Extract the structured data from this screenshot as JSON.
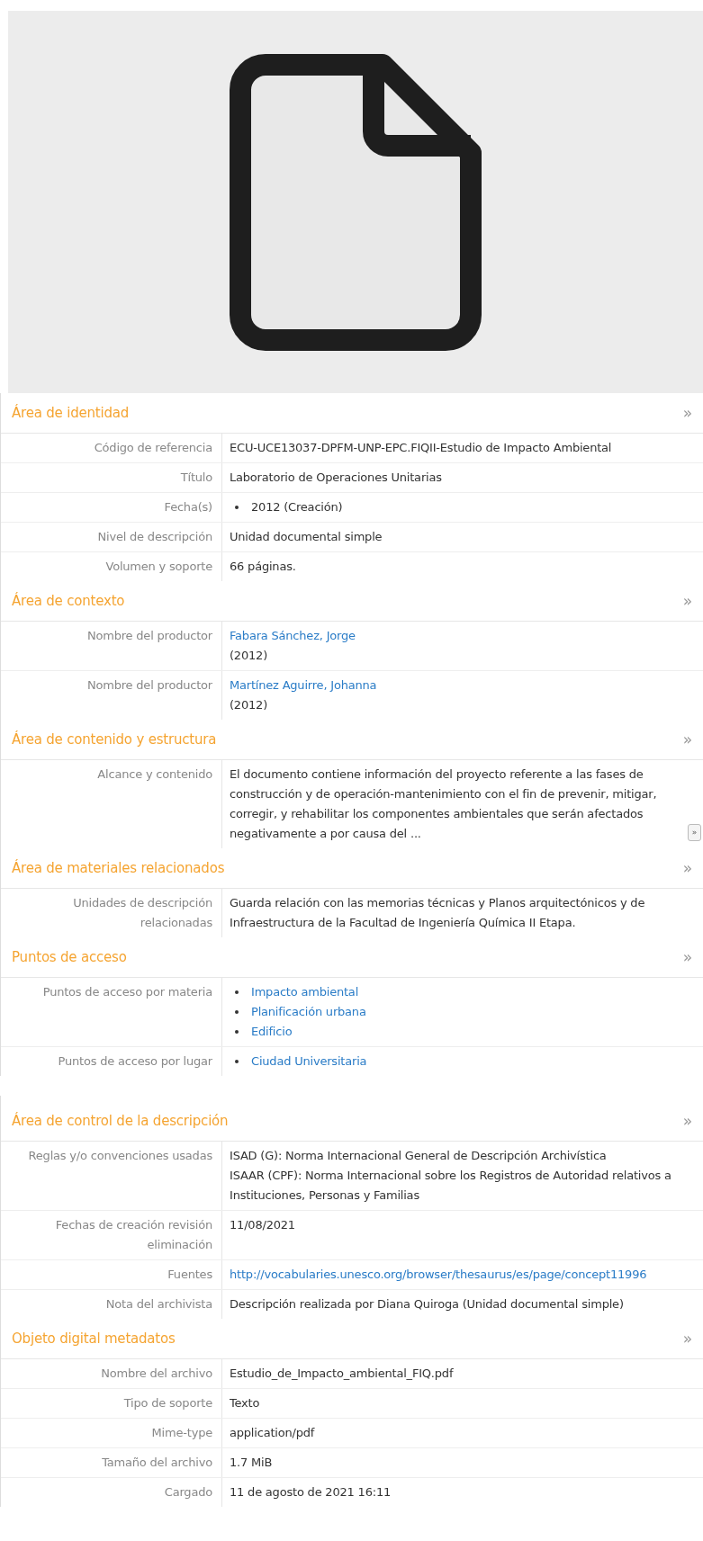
{
  "sections": [
    {
      "title": "Área de identidad",
      "toggle": "»",
      "fields": [
        {
          "label": "Código de referencia",
          "values": [
            {
              "kind": "text",
              "text": "ECU-UCE13037-DPFM-UNP-EPC.FIQII-Estudio de Impacto Ambiental"
            }
          ]
        },
        {
          "label": "Título",
          "values": [
            {
              "kind": "text",
              "text": "Laboratorio de Operaciones Unitarias"
            }
          ]
        },
        {
          "label": "Fecha(s)",
          "values": [
            {
              "kind": "bullet_text",
              "text": "2012 (Creación)"
            }
          ]
        },
        {
          "label": "Nivel de descripción",
          "values": [
            {
              "kind": "text",
              "text": "Unidad documental simple"
            }
          ]
        },
        {
          "label": "Volumen y soporte",
          "values": [
            {
              "kind": "text",
              "text": "66 páginas."
            }
          ]
        }
      ]
    },
    {
      "title": "Área de contexto",
      "toggle": "»",
      "fields": [
        {
          "label": "Nombre del productor",
          "values": [
            {
              "kind": "link",
              "text": "Fabara Sánchez, Jorge"
            },
            {
              "kind": "text",
              "text": "(2012)"
            }
          ]
        },
        {
          "label": "Nombre del productor",
          "values": [
            {
              "kind": "link",
              "text": "Martínez Aguirre, Johanna"
            },
            {
              "kind": "text",
              "text": "(2012)"
            }
          ]
        }
      ]
    },
    {
      "title": "Área de contenido y estructura",
      "toggle": "»",
      "fields": [
        {
          "label": "Alcance y contenido",
          "values": [
            {
              "kind": "text",
              "text": "El documento contiene información del proyecto referente a las fases de construcción y de operación-mantenimiento con el fin de prevenir, mitigar, corregir, y rehabilitar los componentes ambientales que serán afectados negativamente a por causa del ...",
              "more": "»"
            }
          ]
        }
      ]
    },
    {
      "title": "Área de materiales relacionados",
      "toggle": "»",
      "fields": [
        {
          "label": "Unidades de descripción relacionadas",
          "values": [
            {
              "kind": "text",
              "text": "Guarda relación con las memorias técnicas y Planos arquitectónicos y de Infraestructura de la Facultad de Ingeniería Química II Etapa."
            }
          ]
        }
      ]
    },
    {
      "title": "Puntos de acceso",
      "toggle": "»",
      "fields": [
        {
          "label": "Puntos de acceso por materia",
          "values": [
            {
              "kind": "bullet_link",
              "text": "Impacto ambiental"
            },
            {
              "kind": "bullet_link",
              "text": "Planificación urbana"
            },
            {
              "kind": "bullet_link",
              "text": "Edificio"
            }
          ]
        },
        {
          "label": "Puntos de acceso por lugar",
          "values": [
            {
              "kind": "bullet_link",
              "text": "Ciudad Universitaria"
            }
          ]
        }
      ]
    },
    {
      "title": "Área de control de la descripción",
      "toggle": "»",
      "break_before": true,
      "fields": [
        {
          "label": "Reglas y/o convenciones usadas",
          "values": [
            {
              "kind": "text",
              "text": "ISAD (G): Norma Internacional General de Descripción Archivística"
            },
            {
              "kind": "text",
              "text": "ISAAR (CPF): Norma Internacional sobre los Registros de Autoridad relativos a Instituciones, Personas y Familias"
            }
          ]
        },
        {
          "label": "Fechas de creación revisión eliminación",
          "values": [
            {
              "kind": "text",
              "text": "11/08/2021"
            }
          ]
        },
        {
          "label": "Fuentes",
          "values": [
            {
              "kind": "link",
              "text": "http://vocabularies.unesco.org/browser/thesaurus/es/page/concept11996"
            }
          ]
        },
        {
          "label": "Nota del archivista",
          "values": [
            {
              "kind": "text",
              "text": "Descripción realizada por Diana Quiroga (Unidad documental simple)"
            }
          ]
        }
      ]
    },
    {
      "title": "Objeto digital metadatos",
      "toggle": "»",
      "fields": [
        {
          "label": "Nombre del archivo",
          "values": [
            {
              "kind": "text",
              "text": "Estudio_de_Impacto_ambiental_FIQ.pdf"
            }
          ]
        },
        {
          "label": "Tipo de soporte",
          "values": [
            {
              "kind": "text",
              "text": "Texto"
            }
          ]
        },
        {
          "label": "Mime-type",
          "values": [
            {
              "kind": "text",
              "text": "application/pdf"
            }
          ]
        },
        {
          "label": "Tamaño del archivo",
          "values": [
            {
              "kind": "text",
              "text": "1.7 MiB"
            }
          ]
        },
        {
          "label": "Cargado",
          "values": [
            {
              "kind": "text",
              "text": "11 de agosto de 2021 16:11"
            }
          ]
        }
      ]
    }
  ]
}
